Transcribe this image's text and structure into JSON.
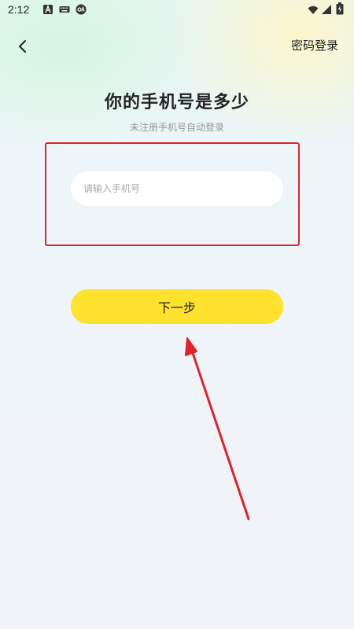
{
  "status_bar": {
    "time": "2:12",
    "icons": [
      "a-notification-icon",
      "keyboard-icon",
      "oa-app-icon",
      "wifi-icon",
      "signal-icon",
      "battery-icon"
    ]
  },
  "header": {
    "back_icon": "chevron-left-icon",
    "password_login_label": "密码登录"
  },
  "main": {
    "title": "你的手机号是多少",
    "subtitle": "未注册手机号自动登录",
    "phone_input": {
      "value": "",
      "placeholder": "请输入手机号"
    },
    "next_button_label": "下一步"
  },
  "colors": {
    "accent_button": "#ffe22e",
    "annotation_red": "#e0222a"
  }
}
